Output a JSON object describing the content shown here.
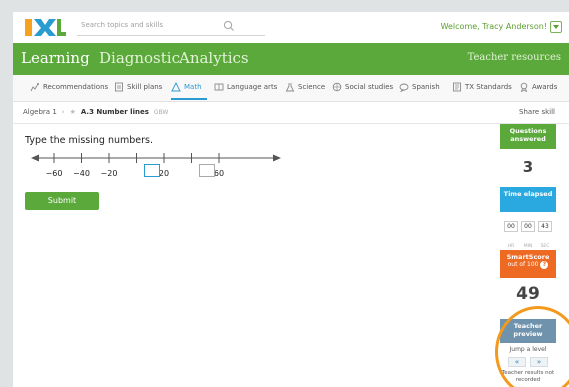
{
  "header": {
    "search_placeholder": "Search topics and skills",
    "welcome": "Welcome, Tracy Anderson!"
  },
  "main_nav": {
    "items": [
      "Learning",
      "Diagnostic",
      "Analytics"
    ],
    "right": "Teacher resources"
  },
  "subject_nav": {
    "items": [
      {
        "label": "Recommendations",
        "icon": "recommendations-icon"
      },
      {
        "label": "Skill plans",
        "icon": "skill-plans-icon"
      },
      {
        "label": "Math",
        "icon": "math-icon"
      },
      {
        "label": "Language arts",
        "icon": "language-arts-icon"
      },
      {
        "label": "Science",
        "icon": "science-icon"
      },
      {
        "label": "Social studies",
        "icon": "social-studies-icon"
      },
      {
        "label": "Spanish",
        "icon": "spanish-icon"
      },
      {
        "label": "TX Standards",
        "icon": "standards-icon"
      },
      {
        "label": "Awards",
        "icon": "awards-icon"
      }
    ],
    "active": "Math"
  },
  "breadcrumb": {
    "course": "Algebra 1",
    "skill": "A.3 Number lines",
    "code": "GBW",
    "share": "Share skill"
  },
  "question": {
    "prompt": "Type the missing numbers.",
    "labels": [
      "−60",
      "−40",
      "−20",
      "",
      "20",
      "",
      "60"
    ],
    "submit": "Submit"
  },
  "sidebar": {
    "questions_label": "Questions answered",
    "questions_value": "3",
    "time_label": "Time elapsed",
    "timer": [
      {
        "value": "00",
        "unit": "HR"
      },
      {
        "value": "00",
        "unit": "MIN"
      },
      {
        "value": "43",
        "unit": "SEC"
      }
    ],
    "smartscore_label": "SmartScore",
    "smartscore_sub": "out of 100",
    "smartscore_value": "49",
    "teacher_preview": "Teacher preview",
    "jump": "Jump a level",
    "prev": "«",
    "next": "»",
    "not_recorded": "Teacher results not recorded"
  },
  "colors": {
    "brand_green": "#5aa93a",
    "accent_blue": "#2a9bd1",
    "timer_blue": "#29a9e0",
    "smartscore_orange": "#ee6a22",
    "preview_blue": "#6f93ad",
    "highlight_orange": "#f39a1e"
  }
}
